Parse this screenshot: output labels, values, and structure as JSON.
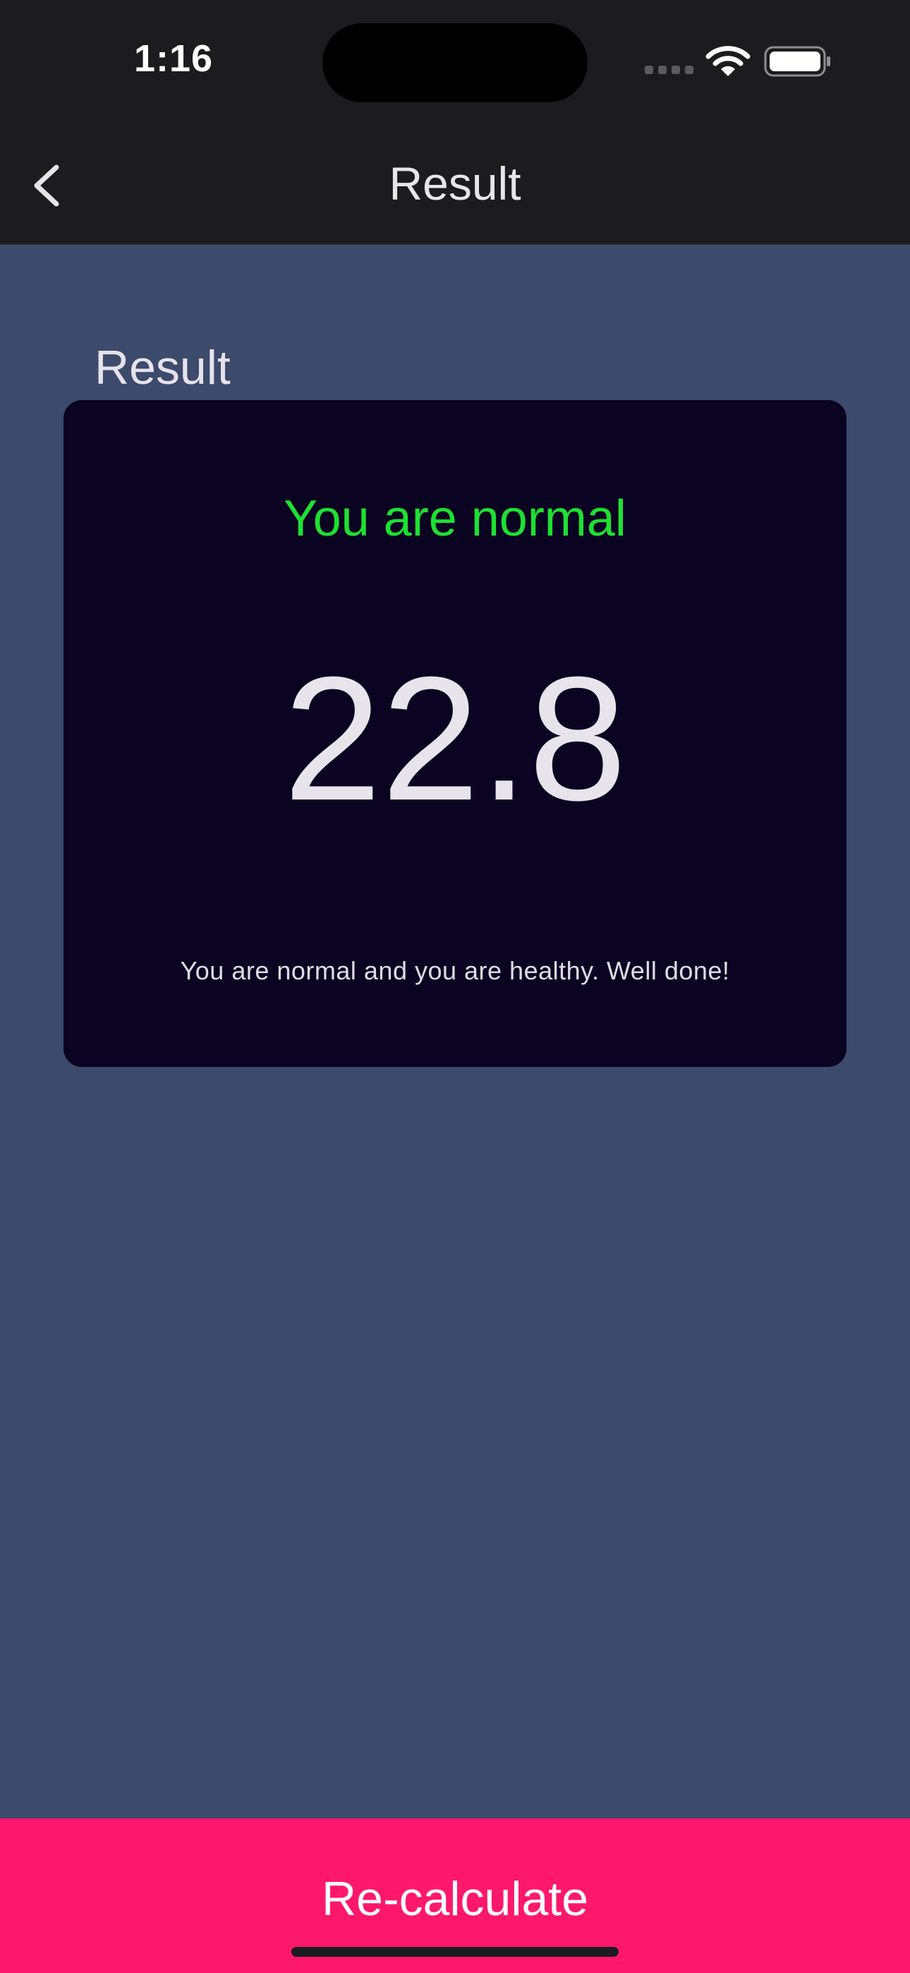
{
  "status_bar": {
    "time": "1:16",
    "icons": [
      "signal-icon",
      "wifi-icon",
      "battery-icon"
    ]
  },
  "nav": {
    "title": "Result",
    "back_icon": "chevron-left-icon"
  },
  "section": {
    "heading": "Result"
  },
  "result_card": {
    "status": "You are normal",
    "bmi": "22.8",
    "advice": "You are normal and you are healthy. Well done!"
  },
  "action": {
    "recalculate_label": "Re-calculate"
  },
  "colors": {
    "background": "#3c4a6b",
    "bar_background": "#1c1c1f",
    "card_background": "#0a0322",
    "status_green": "#1ee032",
    "button_pink": "#fe186c"
  }
}
